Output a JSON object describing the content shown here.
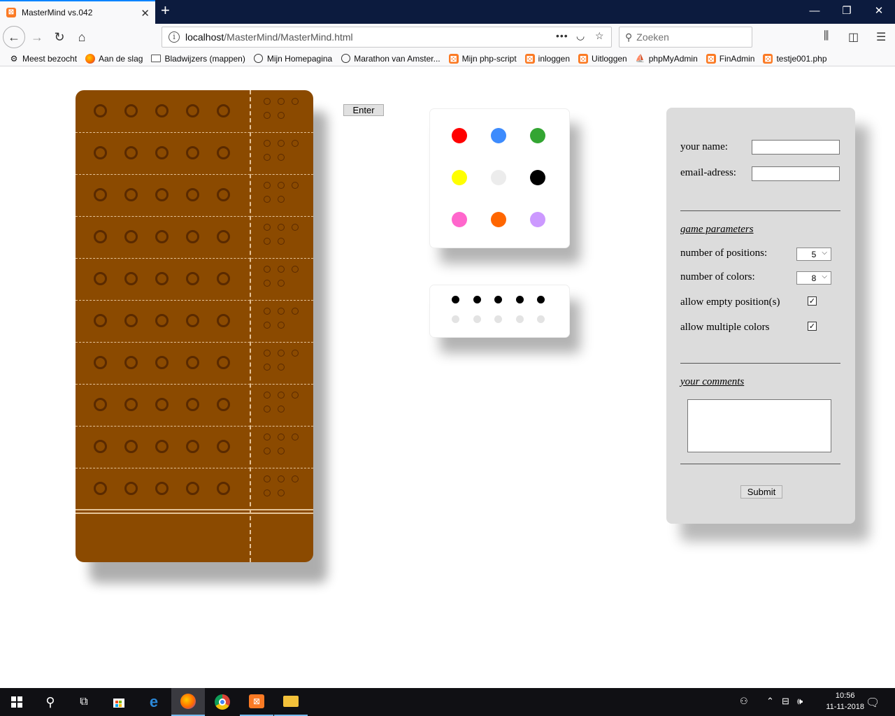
{
  "browser": {
    "tab_title": "MasterMind vs.042",
    "tab_close": "✕",
    "new_tab": "+",
    "url_host": "localhost",
    "url_path": "/MasterMind/MasterMind.html",
    "search_placeholder": "Zoeken",
    "bookmarks": [
      {
        "label": "Meest bezocht",
        "icon": "gear-icon"
      },
      {
        "label": "Aan de slag",
        "icon": "firefox-icon"
      },
      {
        "label": "Bladwijzers (mappen)",
        "icon": "folder-icon"
      },
      {
        "label": "Mijn Homepagina",
        "icon": "globe-icon"
      },
      {
        "label": "Marathon van Amster...",
        "icon": "globe-icon"
      },
      {
        "label": "Mijn php-script",
        "icon": "xampp-icon"
      },
      {
        "label": "inloggen",
        "icon": "xampp-icon"
      },
      {
        "label": "Uitloggen",
        "icon": "xampp-icon"
      },
      {
        "label": "phpMyAdmin",
        "icon": "phpmyadmin-icon"
      },
      {
        "label": "FinAdmin",
        "icon": "xampp-icon"
      },
      {
        "label": "testje001.php",
        "icon": "xampp-icon"
      }
    ]
  },
  "game": {
    "enter_label": "Enter",
    "rows": 10,
    "positions": 5,
    "palette_colors": [
      "#ff0000",
      "#3d8bfd",
      "#33a532",
      "#ffff00",
      "#ececec",
      "#000000",
      "#ff66cc",
      "#ff6600",
      "#cc99ff"
    ],
    "result_top_colors": [
      "#000000",
      "#000000",
      "#000000",
      "#000000",
      "#000000"
    ],
    "result_bottom_colors": [
      "#e3e3e3",
      "#e3e3e3",
      "#e3e3e3",
      "#e3e3e3",
      "#e3e3e3"
    ],
    "board_color": "#8b4a00"
  },
  "settings": {
    "name_label": "your name:",
    "email_label": "email-adress:",
    "game_params_heading": "game parameters",
    "positions_label": "number of positions:",
    "positions_value": "5",
    "colors_label": "number of colors:",
    "colors_value": "8",
    "allow_empty_label": "allow empty position(s)",
    "allow_empty_checked": true,
    "allow_multiple_label": "allow multiple colors",
    "allow_multiple_checked": true,
    "comments_heading": "your comments",
    "submit_label": "Submit"
  },
  "taskbar": {
    "time": "10:56",
    "date": "11-11-2018"
  }
}
